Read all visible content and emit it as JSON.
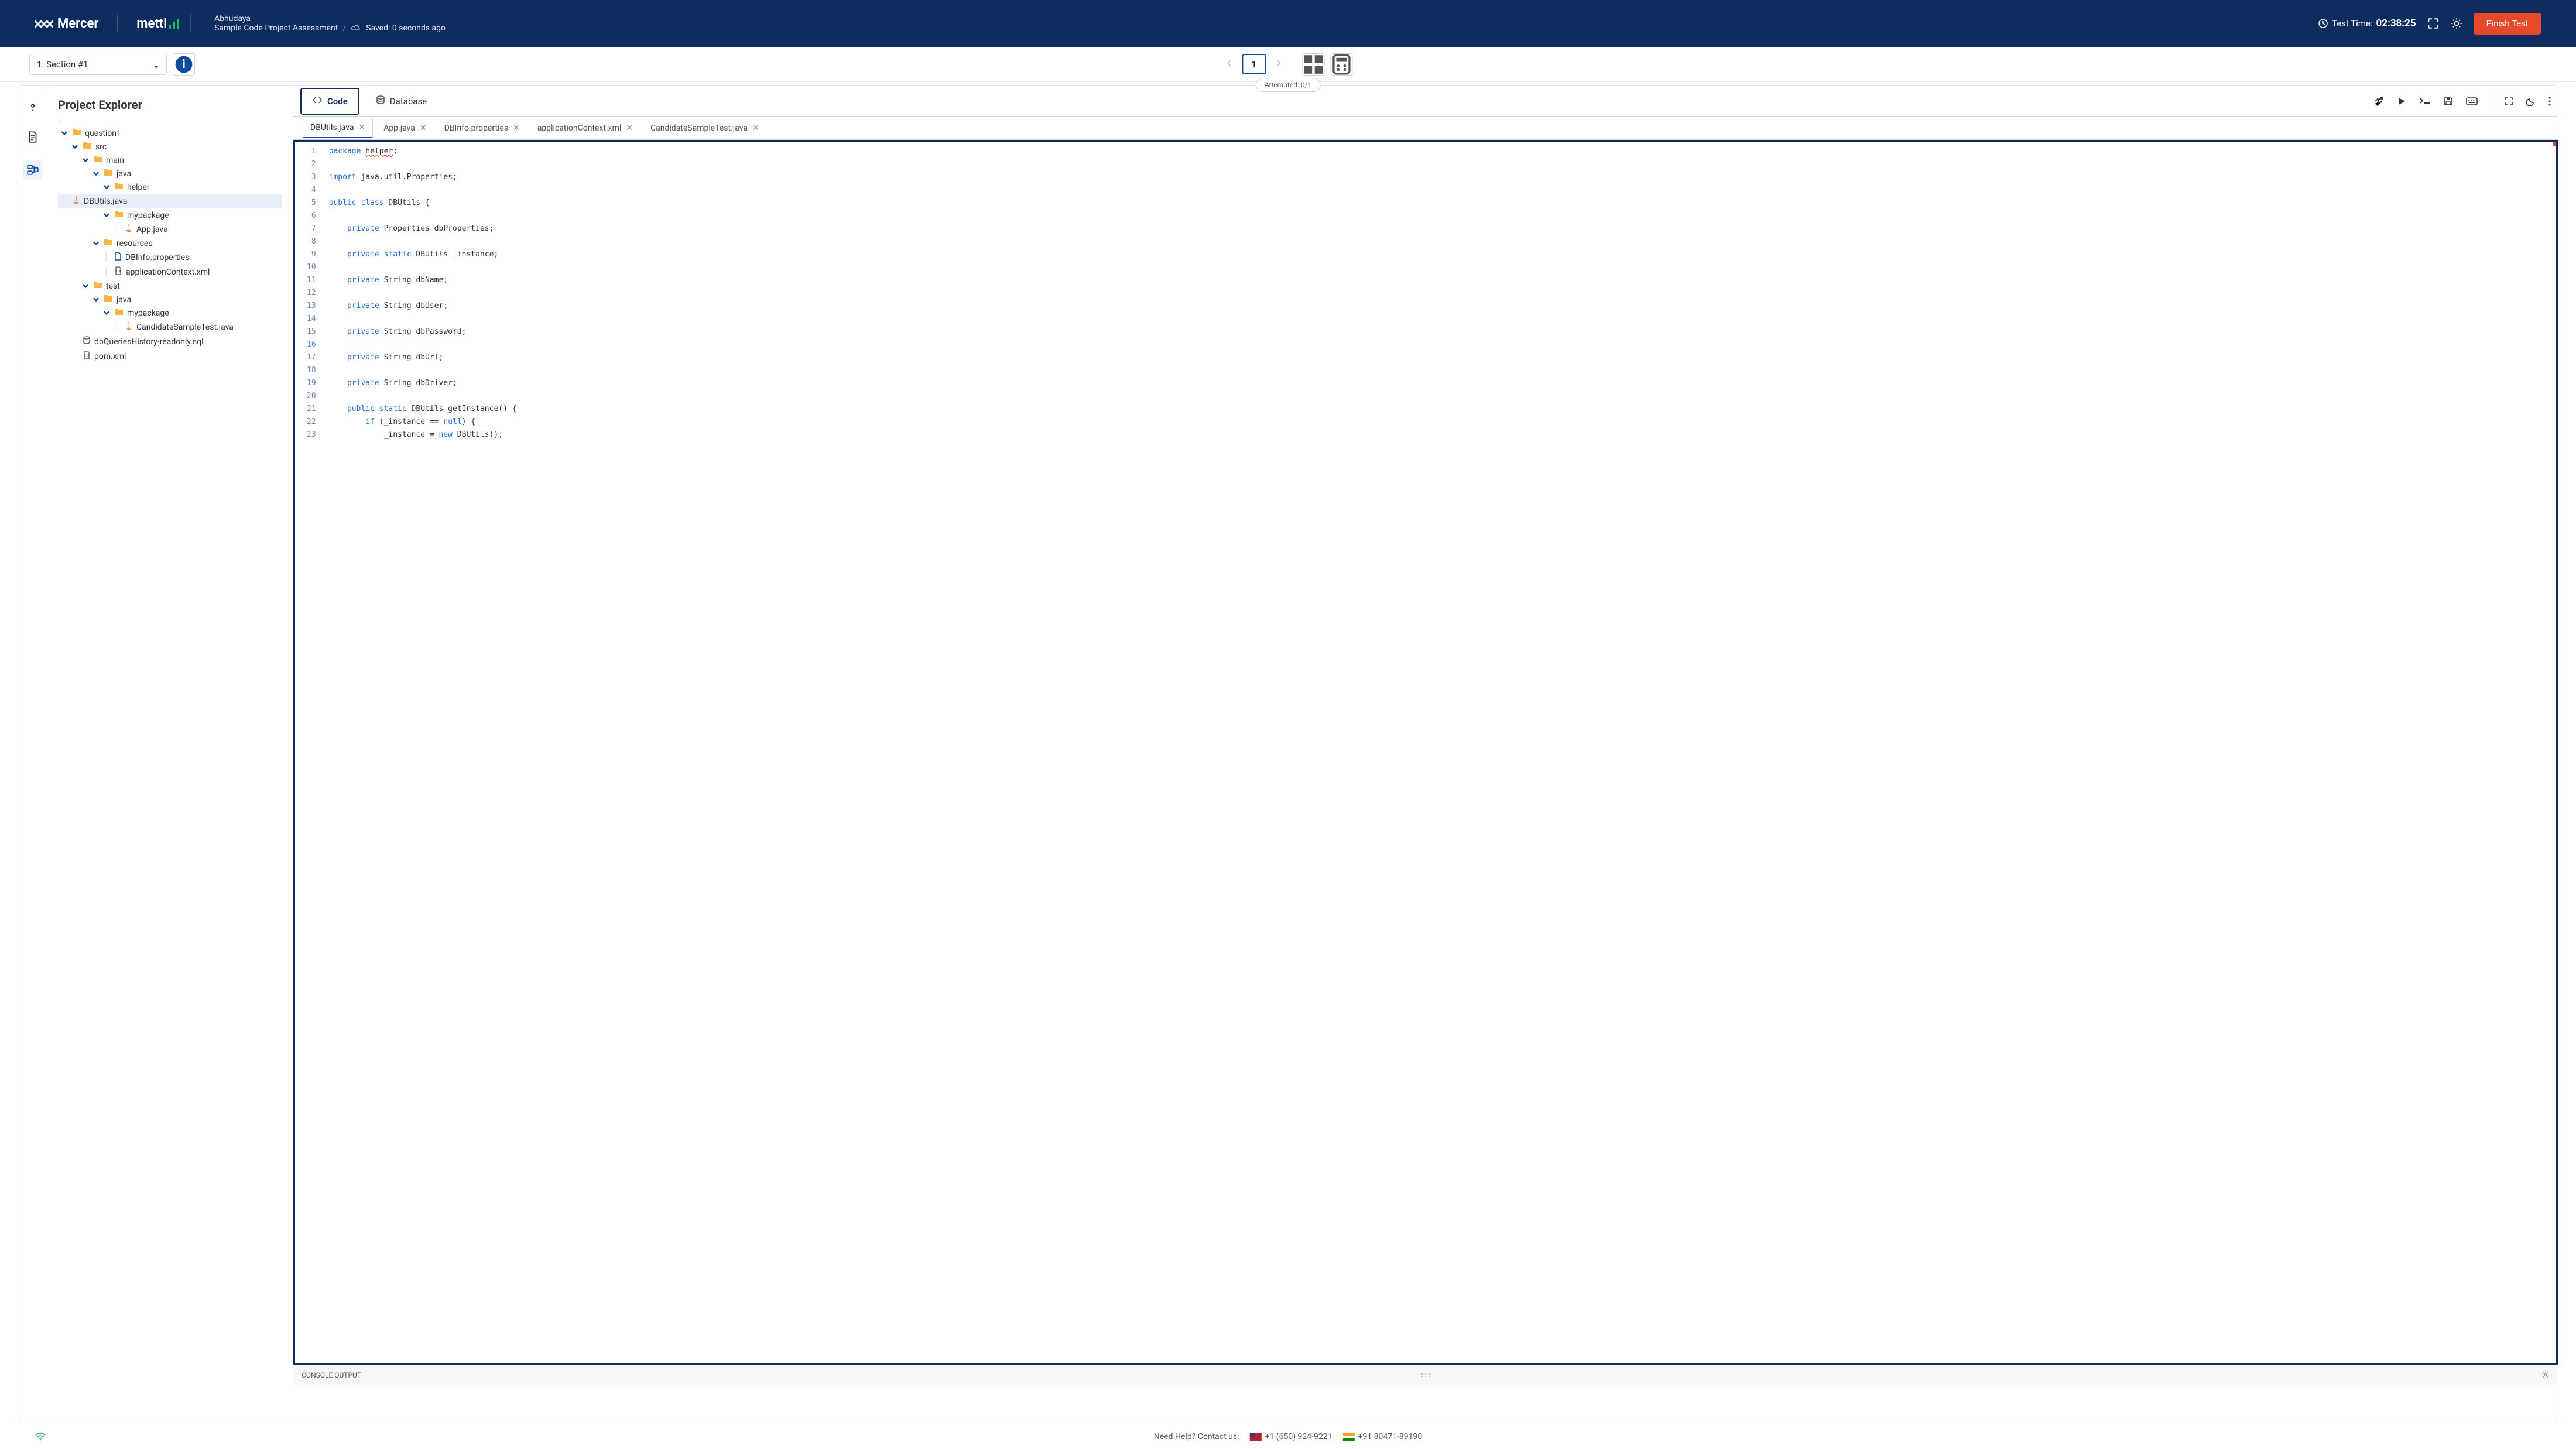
{
  "header": {
    "brand1": "Mercer",
    "brand2": "mettl",
    "user_name": "Abhudaya",
    "breadcrumb": "Sample Code Project Assessment",
    "saved_text": "Saved: 0 seconds ago",
    "test_time_label": "Test Time:",
    "test_time_value": "02:38:25",
    "finish_label": "Finish Test"
  },
  "toolbar": {
    "section_label": "1. Section #1",
    "page_current": "1",
    "attempted_text": "Attempted: 0/1"
  },
  "explorer": {
    "title": "Project Explorer",
    "root_dot": ".",
    "tree": [
      {
        "indent": 0,
        "type": "folder",
        "label": "question1",
        "open": true
      },
      {
        "indent": 1,
        "type": "folder",
        "label": "src",
        "open": true
      },
      {
        "indent": 2,
        "type": "folder",
        "label": "main",
        "open": true
      },
      {
        "indent": 3,
        "type": "folder",
        "label": "java",
        "open": true
      },
      {
        "indent": 4,
        "type": "folder",
        "label": "helper",
        "open": true
      },
      {
        "indent": 5,
        "type": "java",
        "label": "DBUtils.java",
        "selected": true
      },
      {
        "indent": 4,
        "type": "folder",
        "label": "mypackage",
        "open": true
      },
      {
        "indent": 5,
        "type": "java",
        "label": "App.java"
      },
      {
        "indent": 3,
        "type": "folder",
        "label": "resources",
        "open": true
      },
      {
        "indent": 4,
        "type": "file",
        "label": "DBInfo.properties"
      },
      {
        "indent": 4,
        "type": "xml",
        "label": "applicationContext.xml"
      },
      {
        "indent": 2,
        "type": "folder",
        "label": "test",
        "open": true
      },
      {
        "indent": 3,
        "type": "folder",
        "label": "java",
        "open": true
      },
      {
        "indent": 4,
        "type": "folder",
        "label": "mypackage",
        "open": true
      },
      {
        "indent": 5,
        "type": "java",
        "label": "CandidateSampleTest.java"
      },
      {
        "indent": 1,
        "type": "db",
        "label": "dbQueriesHistory-readonly.sql"
      },
      {
        "indent": 1,
        "type": "xml",
        "label": "pom.xml"
      }
    ]
  },
  "editor": {
    "tabs": [
      {
        "label": "Code",
        "active": true,
        "icon": "code"
      },
      {
        "label": "Database",
        "active": false,
        "icon": "database"
      }
    ],
    "file_tabs": [
      {
        "label": "DBUtils.java",
        "active": true
      },
      {
        "label": "App.java"
      },
      {
        "label": "DBInfo.properties"
      },
      {
        "label": "applicationContext.xml"
      },
      {
        "label": "CandidateSampleTest.java"
      }
    ],
    "code_lines": [
      {
        "n": 1,
        "t": [
          {
            "k": 1,
            "v": "package"
          },
          {
            "v": " "
          },
          {
            "err": 1,
            "v": "helper"
          },
          {
            "v": ";"
          }
        ]
      },
      {
        "n": 2,
        "t": []
      },
      {
        "n": 3,
        "t": [
          {
            "k": 1,
            "v": "import"
          },
          {
            "v": " java.util.Properties;"
          }
        ]
      },
      {
        "n": 4,
        "t": []
      },
      {
        "n": 5,
        "t": [
          {
            "k": 1,
            "v": "public"
          },
          {
            "v": " "
          },
          {
            "k": 1,
            "v": "class"
          },
          {
            "v": " DBUtils {"
          }
        ]
      },
      {
        "n": 6,
        "t": []
      },
      {
        "n": 7,
        "t": [
          {
            "v": "    "
          },
          {
            "k": 1,
            "v": "private"
          },
          {
            "v": " Properties dbProperties;"
          }
        ]
      },
      {
        "n": 8,
        "t": []
      },
      {
        "n": 9,
        "t": [
          {
            "v": "    "
          },
          {
            "k": 1,
            "v": "private"
          },
          {
            "v": " "
          },
          {
            "k": 1,
            "v": "static"
          },
          {
            "v": " DBUtils _instance;"
          }
        ]
      },
      {
        "n": 10,
        "t": []
      },
      {
        "n": 11,
        "t": [
          {
            "v": "    "
          },
          {
            "k": 1,
            "v": "private"
          },
          {
            "v": " String dbName;"
          }
        ]
      },
      {
        "n": 12,
        "t": []
      },
      {
        "n": 13,
        "t": [
          {
            "v": "    "
          },
          {
            "k": 1,
            "v": "private"
          },
          {
            "v": " String dbUser;"
          }
        ]
      },
      {
        "n": 14,
        "t": []
      },
      {
        "n": 15,
        "t": [
          {
            "v": "    "
          },
          {
            "k": 1,
            "v": "private"
          },
          {
            "v": " String dbPassword;"
          }
        ]
      },
      {
        "n": 16,
        "t": []
      },
      {
        "n": 17,
        "t": [
          {
            "v": "    "
          },
          {
            "k": 1,
            "v": "private"
          },
          {
            "v": " String dbUrl;"
          }
        ]
      },
      {
        "n": 18,
        "t": []
      },
      {
        "n": 19,
        "t": [
          {
            "v": "    "
          },
          {
            "k": 1,
            "v": "private"
          },
          {
            "v": " String dbDriver;"
          }
        ]
      },
      {
        "n": 20,
        "t": []
      },
      {
        "n": 21,
        "t": [
          {
            "v": "    "
          },
          {
            "k": 1,
            "v": "public"
          },
          {
            "v": " "
          },
          {
            "k": 1,
            "v": "static"
          },
          {
            "v": " DBUtils getInstance() {"
          }
        ]
      },
      {
        "n": 22,
        "t": [
          {
            "v": "        "
          },
          {
            "k": 1,
            "v": "if"
          },
          {
            "v": " (_instance == "
          },
          {
            "k": 1,
            "v": "null"
          },
          {
            "v": ") {"
          }
        ]
      },
      {
        "n": 23,
        "t": [
          {
            "v": "            _instance = "
          },
          {
            "k": 1,
            "v": "new"
          },
          {
            "v": " DBUtils();"
          }
        ]
      }
    ]
  },
  "console": {
    "title": "CONSOLE OUTPUT"
  },
  "footer": {
    "help_text": "Need Help? Contact us:",
    "phone_us": "+1 (650) 924-9221",
    "phone_in": "+91 80471-89190"
  }
}
